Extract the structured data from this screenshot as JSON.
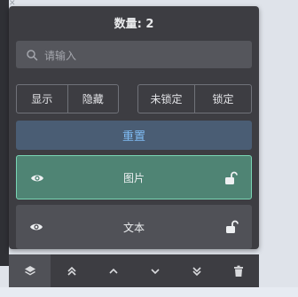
{
  "panel": {
    "title": "数量: 2",
    "search": {
      "placeholder": "请输入",
      "value": ""
    },
    "visibility_group": [
      "显示",
      "隐藏"
    ],
    "lock_group": [
      "未锁定",
      "锁定"
    ],
    "reset_label": "重置",
    "layers": [
      {
        "label": "图片",
        "selected": true,
        "visible": true,
        "locked": false
      },
      {
        "label": "文本",
        "selected": false,
        "visible": true,
        "locked": false
      }
    ]
  },
  "toolbar": {
    "tools": [
      "layers-icon",
      "bring-to-front-icon",
      "move-up-icon",
      "move-down-icon",
      "send-to-back-icon",
      "delete-icon"
    ],
    "active_tool": "layers-icon"
  },
  "colors": {
    "panel_bg": "#3d3d42",
    "selected_layer_bg": "#4f8474",
    "selected_layer_border": "#7ad5b4",
    "reset_text": "#7fbbf3",
    "icon": "#d9dadd"
  }
}
